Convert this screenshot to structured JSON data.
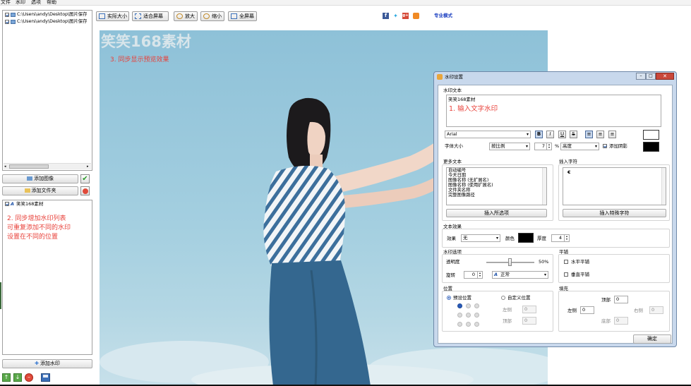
{
  "menu": [
    "文件",
    "水印",
    "选项",
    "帮助"
  ],
  "files": [
    "C:\\Users\\andy\\Desktop\\图片保存",
    "C:\\Users\\andy\\Desktop\\图片保存"
  ],
  "left": {
    "add_image": "添加图像",
    "add_folder": "添加文件夹",
    "watermark_item": "笑笑168素材",
    "note1": "2. 同步增加水印列表",
    "note2": "可重复添加不同的水印",
    "note3": "设置在不同的位置",
    "add_watermark": "添加水印"
  },
  "toolbar": {
    "actual": "实际大小",
    "fit": "适合屏幕",
    "zoom_in": "放大",
    "zoom_out": "缩小",
    "fullscreen": "全屏幕",
    "pro": "专业模式"
  },
  "preview": {
    "watermark": "笑笑168素材",
    "note": "3. 同步显示预览效果"
  },
  "dialog": {
    "title": "水印设置",
    "text_section": "水印文本",
    "text_value": "笑笑168素材",
    "note": "1. 输入文字水印",
    "font": "Arial",
    "size_label": "字体大小",
    "size_mode": "按比例",
    "size_value": "7",
    "percent": "%",
    "size_base": "高度",
    "shadow": "添加阴影",
    "more_text": "更多文本",
    "more_items": [
      "自动编号",
      "今天日期",
      "图像名称 (无扩展名)",
      "图像名称 (使用扩展名)",
      "文件夹名称",
      "完整图像路径"
    ],
    "insert_selected": "插入所选项",
    "insert_char": "插入字符",
    "char_preview": "€",
    "insert_special": "插入特殊字符",
    "effects": "文本效果",
    "effect_label": "效果",
    "effect_value": "无",
    "color_label": "颜色",
    "thickness_label": "厚度",
    "thickness_value": "4",
    "wm_options": "水印选项",
    "opacity_label": "透明度",
    "opacity_value": "50%",
    "rotate_label": "旋转",
    "rotate_value": "0",
    "rotate_mode": "正常",
    "tile": "平铺",
    "tile_h": "水平平铺",
    "tile_v": "垂直平铺",
    "position": "位置",
    "preset": "预设位置",
    "custom": "自定义位置",
    "left_label": "左侧",
    "left_value": "0",
    "top_label": "顶部",
    "top_value": "0",
    "padding": "填充",
    "pad_top_label": "顶部",
    "pad_top": "0",
    "pad_left_label": "左侧",
    "pad_left": "0",
    "pad_right_label": "右侧",
    "pad_right": "0",
    "pad_bottom_label": "底部",
    "pad_bottom": "0",
    "ok": "确定"
  },
  "colors": {
    "accent": "#e8413a",
    "sky": "#9ec9dc",
    "shirt": "#3c6f9c"
  }
}
